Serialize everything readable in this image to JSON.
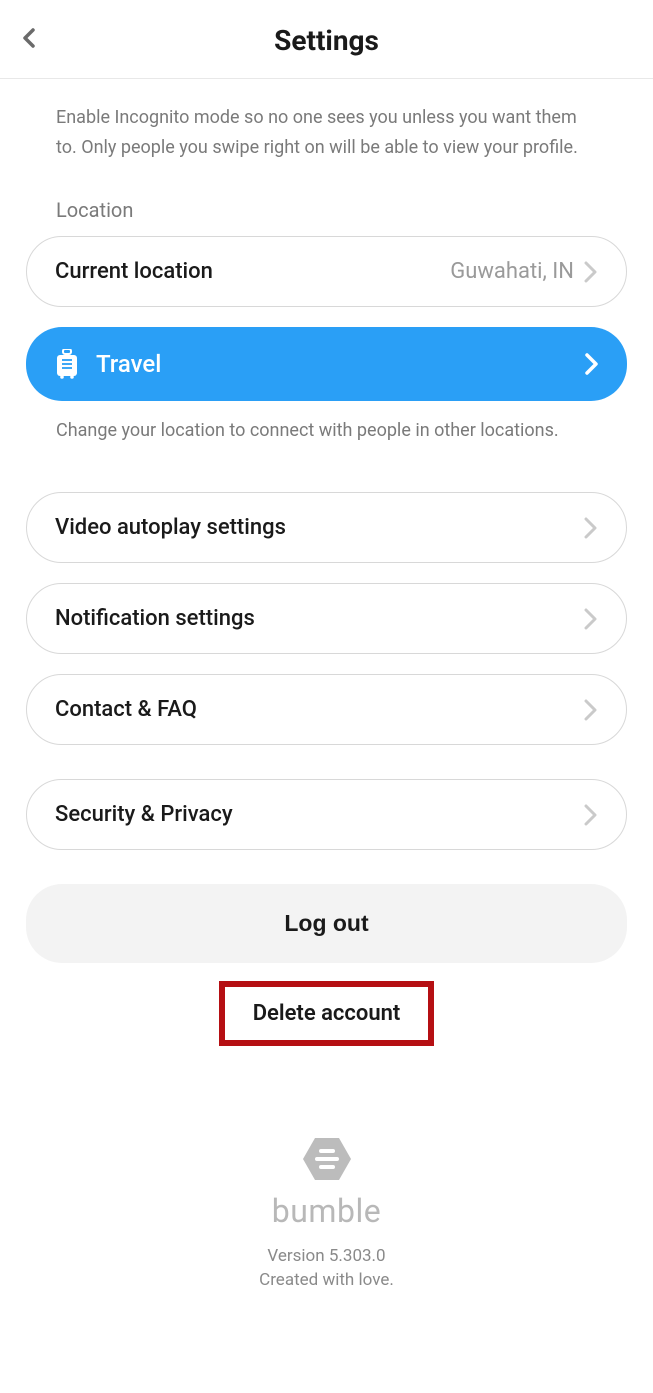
{
  "header": {
    "title": "Settings"
  },
  "incognitoDesc": "Enable Incognito mode so no one sees you unless you want them to. Only people you swipe right on will be able to view your profile.",
  "locationLabel": "Location",
  "currentLocation": {
    "label": "Current location",
    "value": "Guwahati, IN"
  },
  "travel": {
    "label": "Travel"
  },
  "travelDesc": "Change your location to connect with people in other locations.",
  "videoAutoplay": "Video autoplay settings",
  "notification": "Notification settings",
  "contactFaq": "Contact & FAQ",
  "securityPrivacy": "Security & Privacy",
  "logout": "Log out",
  "deleteAccount": "Delete account",
  "brand": "bumble",
  "version": "Version 5.303.0",
  "tagline": "Created with love."
}
